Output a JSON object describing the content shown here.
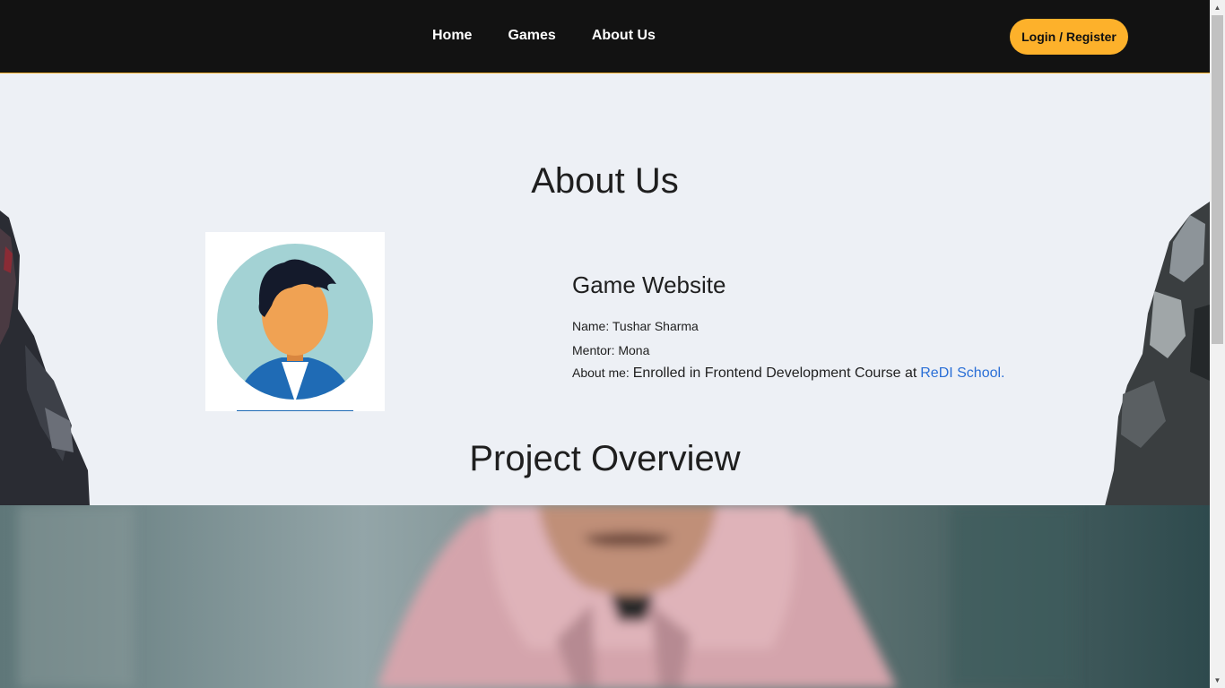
{
  "nav": {
    "links": [
      "Home",
      "Games",
      "About Us"
    ],
    "login_label": "Login / Register"
  },
  "about": {
    "heading": "About Us",
    "card_title": "Game Website",
    "name_label": "Name:",
    "name_value": "Tushar Sharma",
    "mentor_label": "Mentor:",
    "mentor_value": "Mona",
    "about_label": "About me:",
    "about_value": "Enrolled in Frontend Development Course at",
    "school_link": "ReDI School."
  },
  "project": {
    "heading": "Project Overview"
  },
  "colors": {
    "accent": "#fdb12b",
    "navbar": "#121212",
    "background": "#edf0f5",
    "link": "#2a6fd6"
  }
}
